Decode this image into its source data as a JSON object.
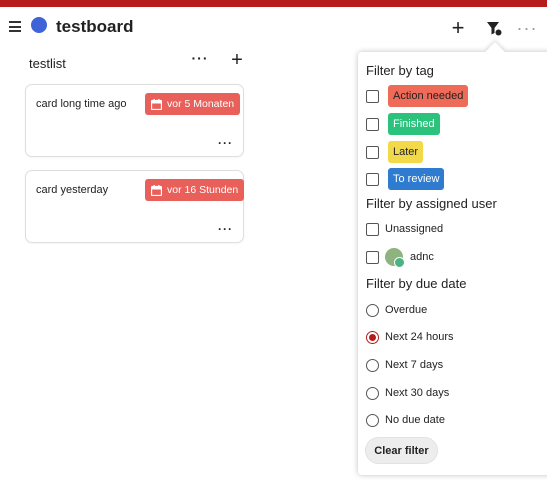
{
  "header": {
    "board_title": "testboard",
    "board_color": "#3f64d8",
    "add_icon": "+",
    "more_icon": "···"
  },
  "list": {
    "title": "testlist",
    "more_icon": "···",
    "add_icon": "+",
    "cards": [
      {
        "title": "card long time ago",
        "due": "vor 5 Monaten",
        "more_icon": "···"
      },
      {
        "title": "card yesterday",
        "due": "vor 16 Stunden",
        "more_icon": "···"
      }
    ]
  },
  "filter": {
    "tag_title": "Filter by tag",
    "tags": [
      {
        "label": "Action needed",
        "color": "#ee6a59",
        "text_color": "#222222"
      },
      {
        "label": "Finished",
        "color": "#2bc27c",
        "text_color": "#ffffff"
      },
      {
        "label": "Later",
        "color": "#f2d94a",
        "text_color": "#222222"
      },
      {
        "label": "To review",
        "color": "#2f7bd0",
        "text_color": "#ffffff"
      }
    ],
    "user_title": "Filter by assigned user",
    "users": [
      "Unassigned",
      "adnc"
    ],
    "due_title": "Filter by due date",
    "due_options": [
      "Overdue",
      "Next 24 hours",
      "Next 7 days",
      "Next 30 days",
      "No due date"
    ],
    "due_selected": "Next 24 hours",
    "clear_label": "Clear filter"
  },
  "colors": {
    "accent": "#b71c1c",
    "due_badge": "#e9605a"
  }
}
